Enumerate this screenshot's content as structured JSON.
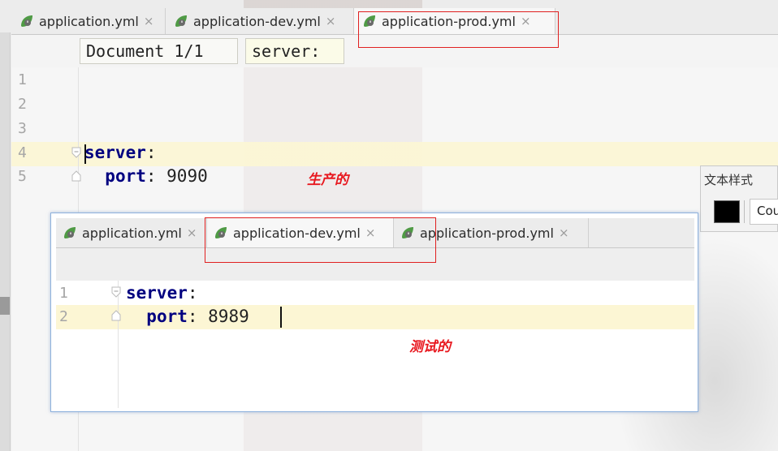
{
  "top_editor": {
    "tabs": [
      {
        "label": "application.yml",
        "icon": "spring-leaf-icon",
        "close": "×"
      },
      {
        "label": "application-dev.yml",
        "icon": "spring-leaf-icon",
        "close": "×"
      },
      {
        "label": "application-prod.yml",
        "icon": "spring-leaf-icon",
        "close": "×",
        "active": true
      }
    ],
    "breadcrumbs": {
      "document": "Document 1/1",
      "node": "server:"
    },
    "line_numbers": [
      "1",
      "2",
      "3",
      "4",
      "5"
    ],
    "code": {
      "line4": {
        "key": "server",
        "colon": ":"
      },
      "line5": {
        "indent": "  ",
        "key": "port",
        "rest": ": 9090"
      }
    },
    "annotation": "生产的"
  },
  "overlay_editor": {
    "tabs": [
      {
        "label": "application.yml",
        "icon": "spring-leaf-icon",
        "close": "×"
      },
      {
        "label": "application-dev.yml",
        "icon": "spring-leaf-icon",
        "close": "×",
        "active": true
      },
      {
        "label": "application-prod.yml",
        "icon": "spring-leaf-icon",
        "close": "×"
      }
    ],
    "line_numbers": [
      "1",
      "2"
    ],
    "code": {
      "line1": {
        "key": "server",
        "colon": ":"
      },
      "line2": {
        "indent": "  ",
        "key": "port",
        "rest": ": 8989"
      }
    },
    "annotation": "测试的"
  },
  "text_style_panel": {
    "title": "文本样式",
    "font_value": "Cou",
    "color": "#000000"
  },
  "colors": {
    "highlight_red": "#e02020",
    "keyword_blue": "#000080",
    "current_line": "#fcf6d4",
    "annotation_red": "#e8181f"
  }
}
